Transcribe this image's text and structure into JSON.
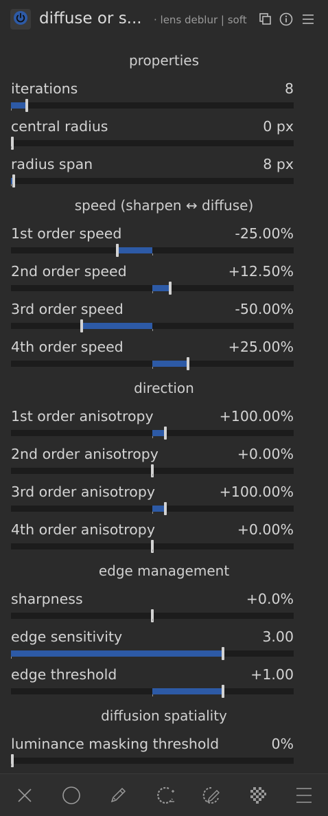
{
  "module": {
    "title": "diffuse or s...",
    "instance": "· lens deblur | soft"
  },
  "sections": {
    "properties": "properties",
    "speed": "speed (sharpen ↔ diffuse)",
    "direction": "direction",
    "edge": "edge management",
    "spatiality": "diffusion spatiality"
  },
  "sliders": {
    "iterations": {
      "label": "iterations",
      "value": "8",
      "fill_from": 0.0,
      "fill_to": 0.055
    },
    "central_radius": {
      "label": "central radius",
      "value": "0 px",
      "fill_from": 0.0,
      "fill_to": 0.0
    },
    "radius_span": {
      "label": "radius span",
      "value": "8 px",
      "fill_from": 0.0,
      "fill_to": 0.01
    },
    "speed1": {
      "label": "1st order speed",
      "value": "-25.00%",
      "fill_from": 0.375,
      "fill_to": 0.5
    },
    "speed2": {
      "label": "2nd order speed",
      "value": "+12.50%",
      "fill_from": 0.5,
      "fill_to": 0.5625
    },
    "speed3": {
      "label": "3rd order speed",
      "value": "-50.00%",
      "fill_from": 0.25,
      "fill_to": 0.5
    },
    "speed4": {
      "label": "4th order speed",
      "value": "+25.00%",
      "fill_from": 0.5,
      "fill_to": 0.625
    },
    "aniso1": {
      "label": "1st order anisotropy",
      "value": "+100.00%",
      "fill_from": 0.5,
      "fill_to": 0.545
    },
    "aniso2": {
      "label": "2nd order anisotropy",
      "value": "+0.00%",
      "fill_from": 0.5,
      "fill_to": 0.5
    },
    "aniso3": {
      "label": "3rd order anisotropy",
      "value": "+100.00%",
      "fill_from": 0.5,
      "fill_to": 0.545
    },
    "aniso4": {
      "label": "4th order anisotropy",
      "value": "+0.00%",
      "fill_from": 0.5,
      "fill_to": 0.5
    },
    "sharpness": {
      "label": "sharpness",
      "value": "+0.0%",
      "fill_from": 0.5,
      "fill_to": 0.5
    },
    "edge_sensitivity": {
      "label": "edge sensitivity",
      "value": "3.00",
      "fill_from": 0.0,
      "fill_to": 0.75
    },
    "edge_threshold": {
      "label": "edge threshold",
      "value": "+1.00",
      "fill_from": 0.5,
      "fill_to": 0.75
    },
    "lum_mask": {
      "label": "luminance masking threshold",
      "value": "0%",
      "fill_from": 0.0,
      "fill_to": 0.0
    }
  },
  "icons": {
    "header": [
      "power-icon",
      "multi-instance-icon",
      "reset-icon",
      "presets-icon"
    ],
    "toolbar": [
      "off-icon",
      "uniform-icon",
      "drawn-mask-icon",
      "parametric-mask-icon",
      "drawn-parametric-mask-icon",
      "raster-mask-icon",
      "menu-icon"
    ]
  },
  "colors": {
    "accent": "#2d5aa6",
    "background": "#2b2b2b"
  }
}
